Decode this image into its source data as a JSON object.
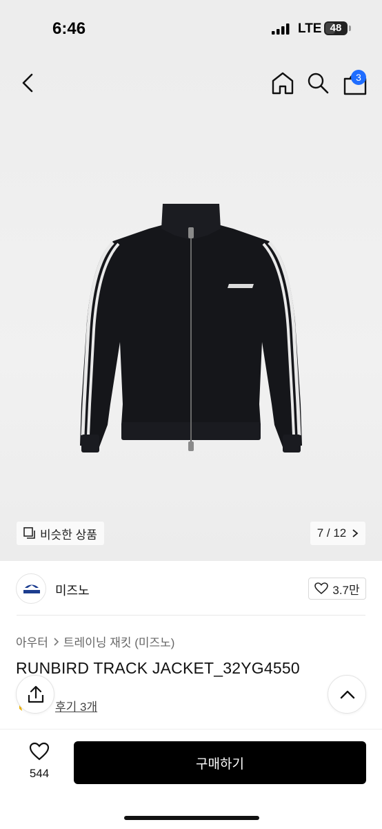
{
  "status": {
    "time": "6:46",
    "network": "LTE",
    "battery": "48",
    "battery_level": 0.48
  },
  "header": {
    "icons": [
      "back-icon",
      "home-icon",
      "search-icon",
      "cart-icon"
    ],
    "cart_count": "3"
  },
  "gallery": {
    "similar_label": "비슷한 상품",
    "counter": "7 / 12"
  },
  "brand": {
    "name": "미즈노",
    "likes": "3.7만"
  },
  "product": {
    "breadcrumb": [
      "아우터",
      "트레이닝 재킷 (미즈노)"
    ],
    "title": "RUNBIRD TRACK JACKET_32YG4550",
    "reviews": "후기 3개"
  },
  "bottom": {
    "wish_count": "544",
    "buy_label": "구매하기"
  },
  "colors": {
    "accent": "#1f6dff",
    "buy_button": "#000000"
  }
}
